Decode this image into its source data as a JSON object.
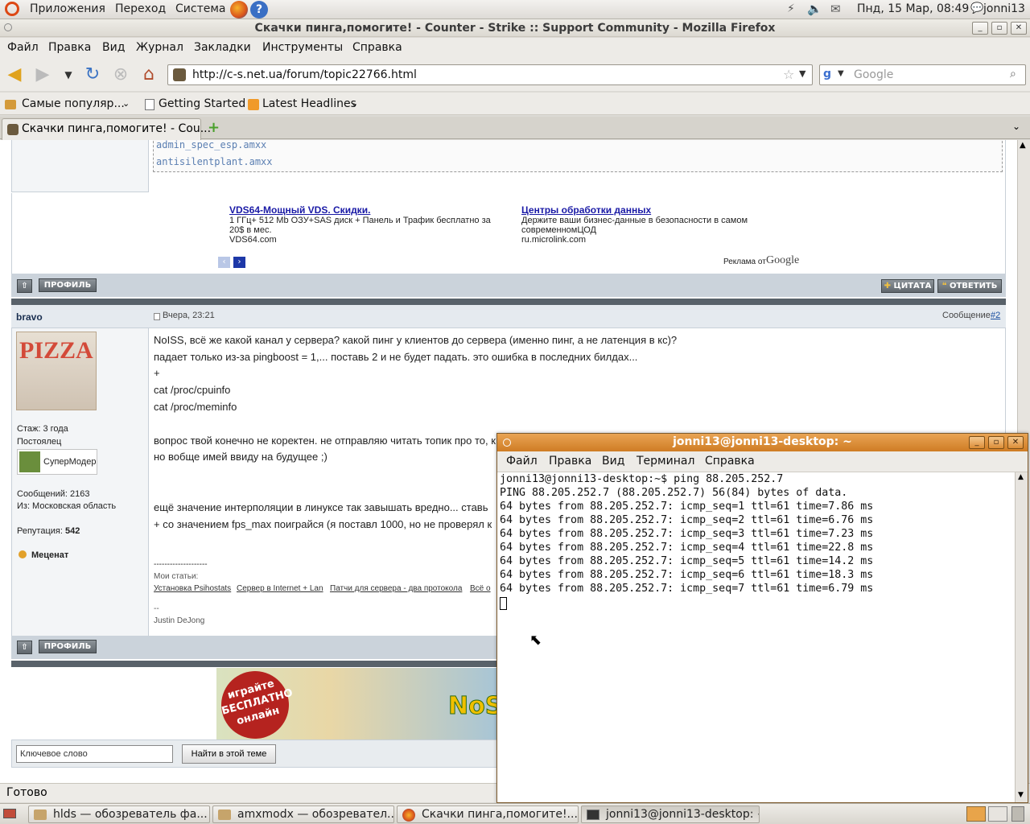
{
  "top_panel": {
    "menus": [
      "Приложения",
      "Переход",
      "Система"
    ],
    "clock": "Пнд, 15 Мар, 08:49",
    "user": "jonni13"
  },
  "firefox": {
    "window_title": "Скачки пинга,помогите! - Counter - Strike :: Support Community - Mozilla Firefox",
    "menu": [
      "Файл",
      "Правка",
      "Вид",
      "Журнал",
      "Закладки",
      "Инструменты",
      "Справка"
    ],
    "url": "http://c-s.net.ua/forum/topic22766.html",
    "search_placeholder": "Google",
    "bookmarks": [
      "Самые популяр...",
      "Getting Started",
      "Latest Headlines"
    ],
    "tab_title": "Скачки пинга,помогите! - Cou...",
    "status": "Готово"
  },
  "page": {
    "code_lines": [
      "admin_spec_esp.amxx",
      "antisilentplant.amxx"
    ],
    "ads": [
      {
        "title": "VDS64-Мощный VDS. Скидки.",
        "text": "1 ГГц+ 512 Mb ОЗУ+SAS диск + Панель и Трафик бесплатно за 20$ в мес.",
        "url": "VDS64.com"
      },
      {
        "title": "Центры обработки данных",
        "text": "Держите ваши бизнес-данные в безопасности в самом современномЦОД",
        "url": "ru.microlink.com"
      }
    ],
    "ads_by": "Реклама от",
    "ads_brand": "Google",
    "btn_profile": "ПРОФИЛЬ",
    "btn_quote": "ЦИТАТА",
    "btn_reply": "ОТВЕТИТЬ",
    "post": {
      "author": "bravo",
      "date": "Вчера, 23:21",
      "msg_label": "Сообщение",
      "msg_num": "#2",
      "avatar_text": "PIZZA",
      "stazh": "Стаж: 3 года",
      "rank": "Постоялец",
      "group": "СуперМодер",
      "messages": "Сообщений: 2163",
      "from": "Из: Московская область",
      "rep_label": "Репутация:",
      "rep_value": "542",
      "award": "Меценат",
      "lines": [
        "NoISS, всё же какой канал у сервера? какой пинг у клиентов до сервера (именно пинг, а не латенция в кс)?",
        "падает только из-за pingboost = 1,... поставь 2 и не будет падать. это ошибка в последних билдах...",
        "+",
        "cat /proc/cpuinfo",
        "cat /proc/meminfo",
        "вопрос твой конечно не коректен. не отправляю читать топик про то, к",
        "но вобще имей ввиду на будущее ;)",
        "ещё значение интерполяции в линуксе так завышать вредно... ставь",
        "+ со значением fps_max поиграйся (я поставл 1000, но не проверял к"
      ],
      "sig_dash": "--------------------",
      "sig_title": "Мои статьи:",
      "sig_links": [
        "Установка Psihostats",
        "Сервер в Internet + Lan",
        "Патчи для сервера - два протокола",
        "Всё о"
      ],
      "sig_tilde": "--",
      "sig_name": "Justin DeJong"
    },
    "banner_text": "играйте БЕСПЛАТНО онлайн",
    "banner_logo": "NoS",
    "search_value": "Ключевое слово",
    "search_button": "Найти в этой теме"
  },
  "terminal": {
    "title": "jonni13@jonni13-desktop: ~",
    "menu": [
      "Файл",
      "Правка",
      "Вид",
      "Терминал",
      "Справка"
    ],
    "lines": [
      "jonni13@jonni13-desktop:~$ ping 88.205.252.7",
      "PING 88.205.252.7 (88.205.252.7) 56(84) bytes of data.",
      "64 bytes from 88.205.252.7: icmp_seq=1 ttl=61 time=7.86 ms",
      "64 bytes from 88.205.252.7: icmp_seq=2 ttl=61 time=6.76 ms",
      "64 bytes from 88.205.252.7: icmp_seq=3 ttl=61 time=7.23 ms",
      "64 bytes from 88.205.252.7: icmp_seq=4 ttl=61 time=22.8 ms",
      "64 bytes from 88.205.252.7: icmp_seq=5 ttl=61 time=14.2 ms",
      "64 bytes from 88.205.252.7: icmp_seq=6 ttl=61 time=18.3 ms",
      "64 bytes from 88.205.252.7: icmp_seq=7 ttl=61 time=6.79 ms"
    ]
  },
  "taskbar": [
    "hlds — обозреватель фа...",
    "amxmodx — обозревател...",
    "Скачки пинга,помогите!...",
    "jonni13@jonni13-desktop: ~"
  ],
  "colors": {
    "terminal_title": "#d98a33",
    "forum_bar": "#cbd3db",
    "forum_sep": "#59626a",
    "link": "#1a4fa0"
  }
}
